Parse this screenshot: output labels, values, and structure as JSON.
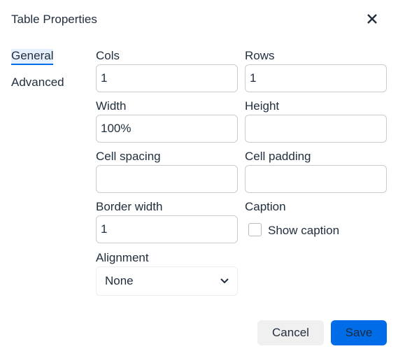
{
  "dialog": {
    "title": "Table Properties",
    "close_icon": "close-icon"
  },
  "tabs": [
    {
      "label": "General",
      "active": true
    },
    {
      "label": "Advanced",
      "active": false
    }
  ],
  "fields": {
    "cols": {
      "label": "Cols",
      "value": "1"
    },
    "rows": {
      "label": "Rows",
      "value": "1"
    },
    "width": {
      "label": "Width",
      "value": "100%"
    },
    "height": {
      "label": "Height",
      "value": ""
    },
    "cell_spacing": {
      "label": "Cell spacing",
      "value": ""
    },
    "cell_padding": {
      "label": "Cell padding",
      "value": ""
    },
    "border_width": {
      "label": "Border width",
      "value": "1"
    },
    "caption": {
      "label": "Caption",
      "checkbox_label": "Show caption",
      "checked": false
    },
    "alignment": {
      "label": "Alignment",
      "value": "None"
    }
  },
  "buttons": {
    "cancel": "Cancel",
    "save": "Save"
  },
  "colors": {
    "accent": "#006ce7",
    "text": "#222f3e"
  }
}
